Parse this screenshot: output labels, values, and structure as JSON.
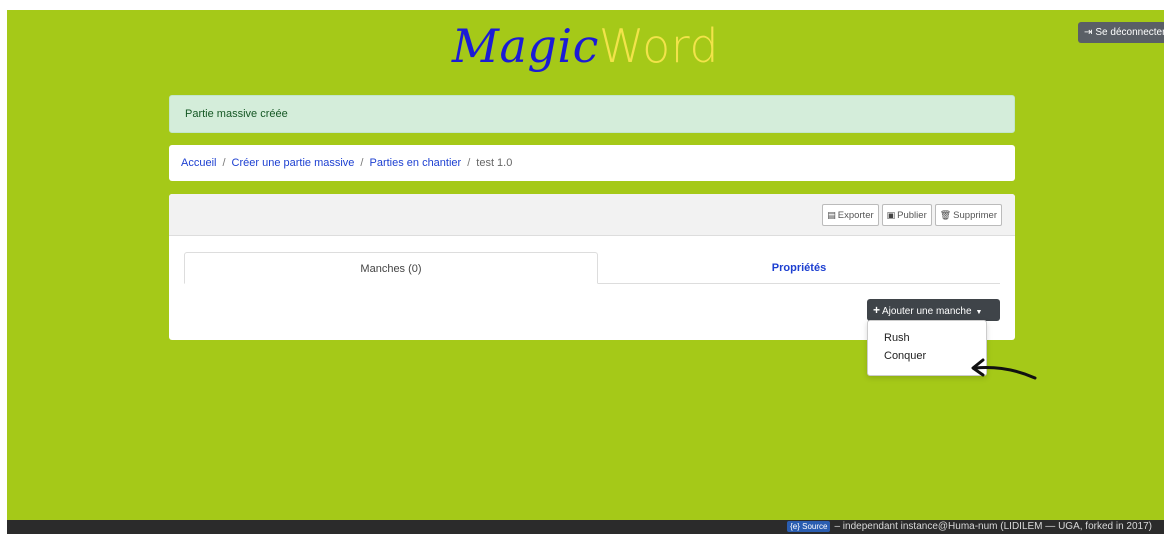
{
  "header": {
    "logo_magic": "Magic",
    "logo_word": "Word",
    "logout_label": "Se déconnecter",
    "logout_icon": "sign-out-icon"
  },
  "alert": {
    "message": "Partie massive créée"
  },
  "breadcrumb": {
    "items": [
      "Accueil",
      "Créer une partie massive",
      "Parties en chantier"
    ],
    "separator": "/",
    "current": "test 1.0"
  },
  "toolbar": {
    "export_label": "Exporter",
    "publish_label": "Publier",
    "delete_label": "Supprimer"
  },
  "tabs": [
    {
      "label": "Manches (0)",
      "active": true
    },
    {
      "label": "Propriétés",
      "active": false
    }
  ],
  "add_round": {
    "label": "Ajouter une manche",
    "options": [
      "Rush",
      "Conquer"
    ]
  },
  "footer": {
    "badge": "{e} Source",
    "text": "– independant instance@Huma-num (LIDILEM — UGA, forked in 2017)"
  },
  "colors": {
    "background": "#a5c918",
    "logo_magic": "#1b1bd6",
    "logo_word": "#f2e34a",
    "alert_bg": "#d4edda",
    "link": "#1c3fd1",
    "dark_button": "#3f4449"
  }
}
